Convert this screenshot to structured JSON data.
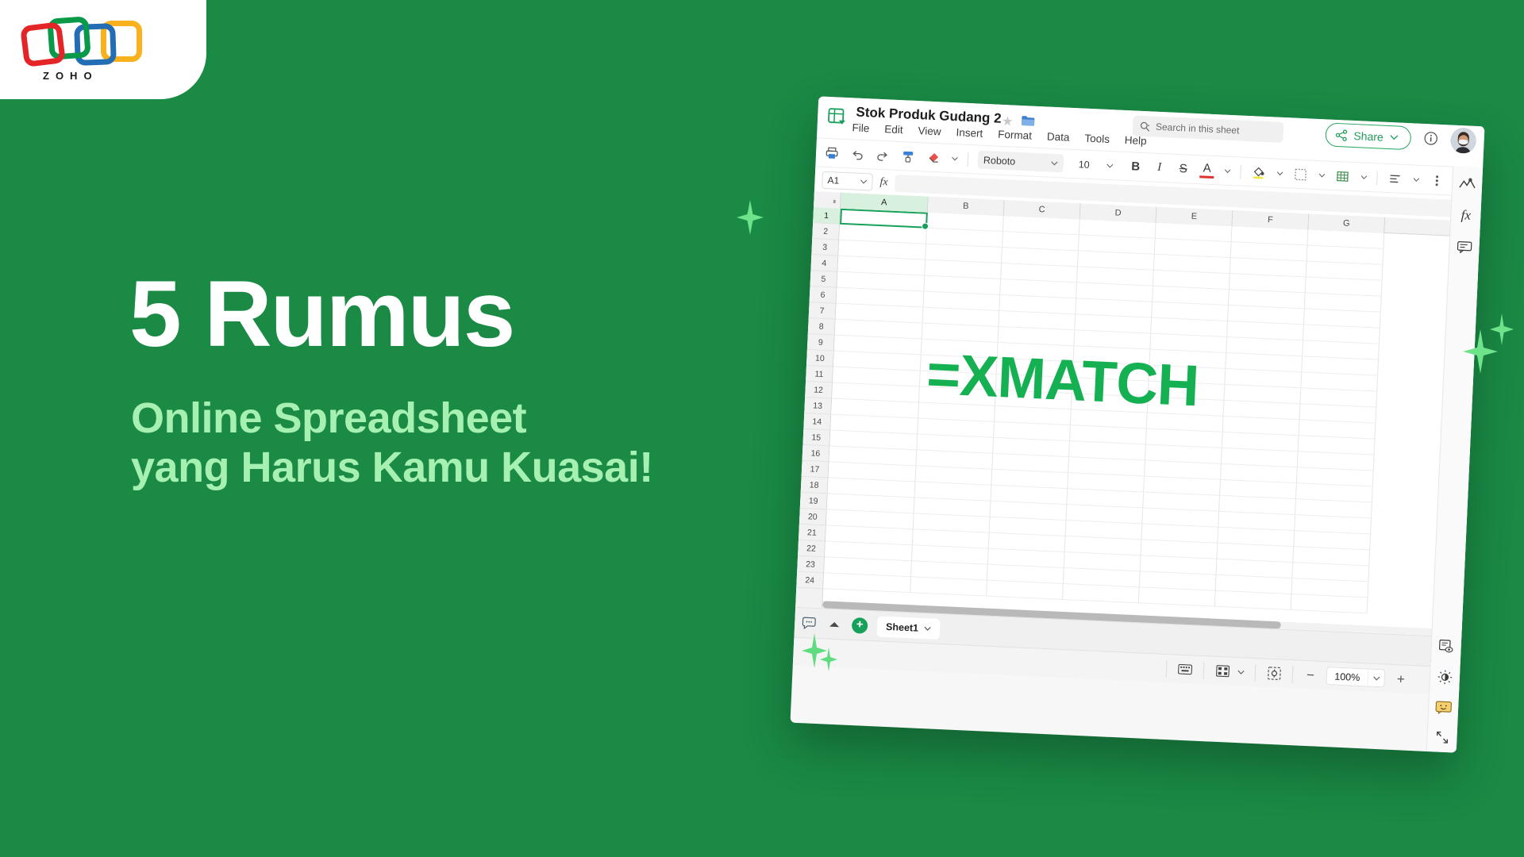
{
  "brand": {
    "name": "ZOHO",
    "logo_colors": [
      "#e42527",
      "#089949",
      "#226db4",
      "#f9b21d"
    ],
    "background_green": "#1a8a45"
  },
  "promo": {
    "headline": "5 Rumus",
    "subheadline_line1": "Online Spreadsheet",
    "subheadline_line2": "yang Harus Kamu Kuasai!",
    "headline_color": "#ffffff",
    "subheadline_color": "#a6f0b2"
  },
  "app": {
    "doc_title": "Stok Produk Gudang 2",
    "doc_icon": "spreadsheet-icon",
    "star_icon": "star-icon",
    "folder_icon": "folder-icon",
    "menu": [
      "File",
      "Edit",
      "View",
      "Insert",
      "Format",
      "Data",
      "Tools",
      "Help"
    ],
    "search": {
      "placeholder": "Search in this sheet",
      "icon": "search-icon"
    },
    "share": {
      "label": "Share",
      "icon": "share-icon",
      "color": "#1f9e59"
    },
    "info_icon": "info-icon",
    "avatar": "user-avatar",
    "toolbar": {
      "icons": [
        "print-icon",
        "undo-icon",
        "redo-icon",
        "paint-format-icon",
        "eraser-icon"
      ],
      "font_name": "Roboto",
      "font_size": "10",
      "bold": "B",
      "italic": "I",
      "strikethrough": "S",
      "text_color": "A",
      "fill_color_icon": "fill-color-icon",
      "borders_icon": "borders-icon",
      "merge_icon": "merge-cells-icon",
      "align_icon": "align-left-icon",
      "more_icon": "more-options-icon"
    },
    "formula_bar": {
      "cell_reference": "A1",
      "fx_label": "fx",
      "formula_value": ""
    },
    "grid": {
      "columns": [
        "A",
        "B",
        "C",
        "D",
        "E",
        "F",
        "G"
      ],
      "rows": [
        1,
        2,
        3,
        4,
        5,
        6,
        7,
        8,
        9,
        10,
        11,
        12,
        13,
        14,
        15,
        16,
        17,
        18,
        19,
        20,
        21,
        22,
        23,
        24
      ],
      "selected_cell": "A1",
      "overlay_text": "=XMATCH",
      "overlay_color": "#14b051"
    },
    "sheet_bar": {
      "comment_icon": "comment-icon",
      "collapse_icon": "collapse-up-icon",
      "add_sheet_icon": "add-sheet-icon",
      "tabs": [
        {
          "label": "Sheet1",
          "active": true
        }
      ]
    },
    "status_bar": {
      "keyboard_icon": "keyboard-shortcuts-icon",
      "layout_icon": "sheet-layout-icon",
      "fit_icon": "fit-to-screen-icon",
      "zoom_out": "−",
      "zoom_level": "100%",
      "zoom_in": "+",
      "fullscreen_icon": "fullscreen-icon"
    },
    "right_rail": {
      "top_icons": [
        "image-chart-icon",
        "functions-fx-icon",
        "comments-icon"
      ],
      "bottom_icons": [
        "preview-icon",
        "theme-brightness-icon",
        "sticker-icon",
        "expand-icon"
      ]
    }
  }
}
